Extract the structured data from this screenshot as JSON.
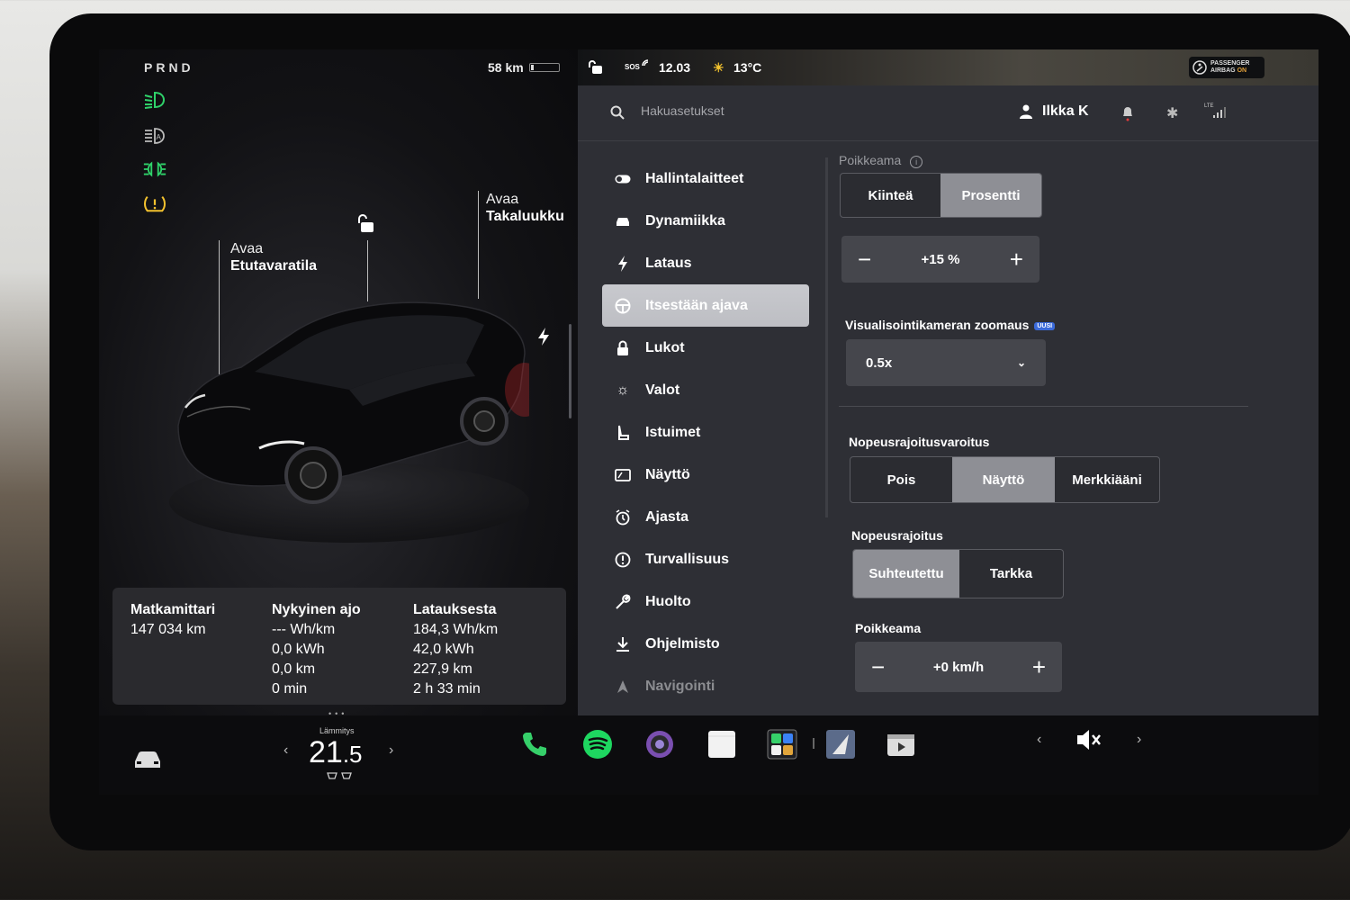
{
  "left": {
    "gear": "PRND",
    "range": "58 km",
    "frunk_label_1": "Avaa",
    "frunk_label_2": "Etutavaratila",
    "trunk_label_1": "Avaa",
    "trunk_label_2": "Takaluukku",
    "trip": {
      "odometer": {
        "title": "Matkamittari",
        "value": "147 034 km"
      },
      "current": {
        "title": "Nykyinen ajo",
        "values": [
          "--- Wh/km",
          "0,0 kWh",
          "0,0 km",
          "0 min"
        ]
      },
      "since_charge": {
        "title": "Latauksesta",
        "values": [
          "184,3 Wh/km",
          "42,0 kWh",
          "227,9 km",
          "2 h 33 min"
        ]
      }
    }
  },
  "status": {
    "sos": "SOS",
    "time": "12.03",
    "temp": "13°C",
    "airbag_line1": "PASSENGER",
    "airbag_line2": "AIRBAG",
    "airbag_on": "ON"
  },
  "search": {
    "placeholder": "Hakuasetukset"
  },
  "user": {
    "name": "Ilkka K"
  },
  "lte": "LTE",
  "menu": [
    {
      "label": "Hallintalaitteet"
    },
    {
      "label": "Dynamiikka"
    },
    {
      "label": "Lataus"
    },
    {
      "label": "Itsestään ajava"
    },
    {
      "label": "Lukot"
    },
    {
      "label": "Valot"
    },
    {
      "label": "Istuimet"
    },
    {
      "label": "Näyttö"
    },
    {
      "label": "Ajasta"
    },
    {
      "label": "Turvallisuus"
    },
    {
      "label": "Huolto"
    },
    {
      "label": "Ohjelmisto"
    },
    {
      "label": "Navigointi"
    }
  ],
  "settings": {
    "offset_title": "Poikkeama",
    "offset_mode": {
      "options": [
        "Kiinteä",
        "Prosentti"
      ],
      "selected": "Prosentti"
    },
    "offset_value": "+15 %",
    "zoom_title": "Visualisointikameran zoomaus",
    "zoom_badge": "UUSI",
    "zoom_value": "0.5x",
    "warning_title": "Nopeusrajoitusvaroitus",
    "warning": {
      "options": [
        "Pois",
        "Näyttö",
        "Merkkiääni"
      ],
      "selected": "Näyttö"
    },
    "limit_title": "Nopeusrajoitus",
    "limit": {
      "options": [
        "Suhteutettu",
        "Tarkka"
      ],
      "selected": "Suhteutettu"
    },
    "limit_offset_title": "Poikkeama",
    "limit_offset_value": "+0 km/h"
  },
  "dock": {
    "temp_label": "Lämmitys",
    "temp_whole": "21",
    "temp_decimal": ".5"
  },
  "colors": {
    "accent_green": "#2fd26a",
    "warning_yellow": "#f2c12e",
    "selected_seg": "#8e8f95"
  }
}
